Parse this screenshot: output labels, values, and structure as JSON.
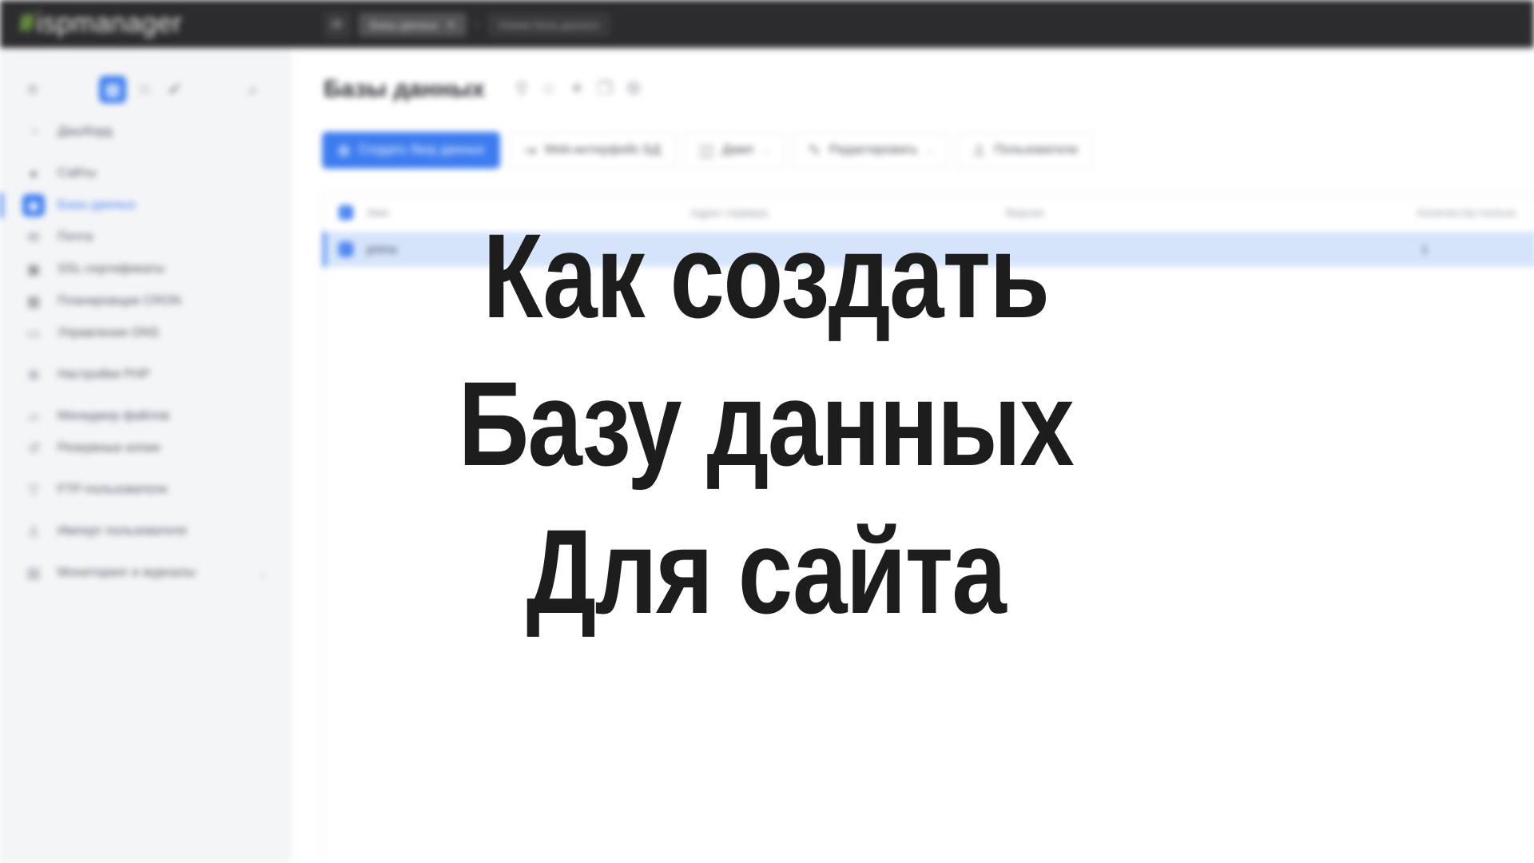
{
  "app": {
    "logo_text": "ispmanager",
    "logo_mark": "#"
  },
  "topbar": {
    "tabs": [
      {
        "label": "Базы данных",
        "close": "✕"
      },
      {
        "label": "Новая база данных"
      }
    ],
    "separator": "›"
  },
  "sidebar": {
    "items": [
      {
        "label": "Дашборд",
        "icon": "dashboard-icon"
      },
      {
        "label": "Сайты",
        "icon": "globe-icon"
      },
      {
        "label": "Базы данных",
        "icon": "database-icon",
        "active": true
      },
      {
        "label": "Почта",
        "icon": "mail-icon"
      },
      {
        "label": "SSL-сертификаты",
        "icon": "lock-icon"
      },
      {
        "label": "Планировщик CRON",
        "icon": "calendar-icon"
      },
      {
        "label": "Управление DNS",
        "icon": "dns-icon"
      },
      {
        "label": "Настройки PHP",
        "icon": "php-icon"
      },
      {
        "label": "Менеджер файлов",
        "icon": "folder-icon"
      },
      {
        "label": "Резервные копии",
        "icon": "backup-icon"
      },
      {
        "label": "FTP-пользователи",
        "icon": "ftp-icon"
      },
      {
        "label": "Импорт пользователя",
        "icon": "user-import-icon"
      },
      {
        "label": "Мониторинг и журналы",
        "icon": "monitor-icon"
      }
    ]
  },
  "main": {
    "title": "Базы данных",
    "toolbar": {
      "create": "Создать базу данных",
      "web_ui": "Web-интерфейс БД",
      "dump": "Дамп",
      "edit": "Редактировать",
      "users": "Пользователи"
    },
    "table": {
      "headers": {
        "name": "Имя",
        "server": "Адрес сервера",
        "version": "Версия",
        "count": "Количество пользо"
      },
      "rows": [
        {
          "name": "prima",
          "count": "1"
        }
      ]
    }
  },
  "overlay": {
    "line1": "Как создать",
    "line2": "Базу данных",
    "line3": "Для сайта"
  },
  "colors": {
    "accent": "#3d7cf0",
    "topbar": "#2c2c2e",
    "sidebar": "#f4f5f7",
    "headline": "#1d1d1d"
  }
}
